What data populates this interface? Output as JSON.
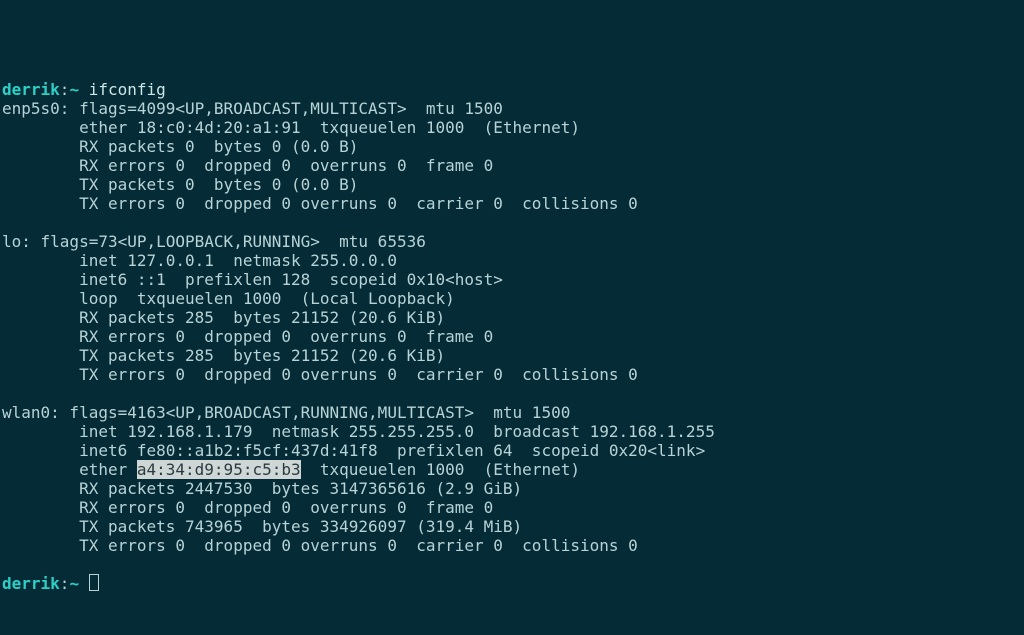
{
  "prompt1": {
    "user": "derrik",
    "sep": ":",
    "path": "~",
    "command": "ifconfig"
  },
  "prompt2": {
    "user": "derrik",
    "sep": ":",
    "path": "~",
    "command": ""
  },
  "iface1": {
    "header": "enp5s0: flags=4099<UP,BROADCAST,MULTICAST>  mtu 1500",
    "l2": "        ether 18:c0:4d:20:a1:91  txqueuelen 1000  (Ethernet)",
    "l3": "        RX packets 0  bytes 0 (0.0 B)",
    "l4": "        RX errors 0  dropped 0  overruns 0  frame 0",
    "l5": "        TX packets 0  bytes 0 (0.0 B)",
    "l6": "        TX errors 0  dropped 0 overruns 0  carrier 0  collisions 0"
  },
  "iface2": {
    "header": "lo: flags=73<UP,LOOPBACK,RUNNING>  mtu 65536",
    "l2": "        inet 127.0.0.1  netmask 255.0.0.0",
    "l3": "        inet6 ::1  prefixlen 128  scopeid 0x10<host>",
    "l4": "        loop  txqueuelen 1000  (Local Loopback)",
    "l5": "        RX packets 285  bytes 21152 (20.6 KiB)",
    "l6": "        RX errors 0  dropped 0  overruns 0  frame 0",
    "l7": "        TX packets 285  bytes 21152 (20.6 KiB)",
    "l8": "        TX errors 0  dropped 0 overruns 0  carrier 0  collisions 0"
  },
  "iface3": {
    "header": "wlan0: flags=4163<UP,BROADCAST,RUNNING,MULTICAST>  mtu 1500",
    "l2": "        inet 192.168.1.179  netmask 255.255.255.0  broadcast 192.168.1.255",
    "l3": "        inet6 fe80::a1b2:f5cf:437d:41f8  prefixlen 64  scopeid 0x20<link>",
    "l4a": "        ether ",
    "l4sel": "a4:34:d9:95:c5:b3",
    "l4b": "  txqueuelen 1000  (Ethernet)",
    "l5": "        RX packets 2447530  bytes 3147365616 (2.9 GiB)",
    "l6": "        RX errors 0  dropped 0  overruns 0  frame 0",
    "l7": "        TX packets 743965  bytes 334926097 (319.4 MiB)",
    "l8": "        TX errors 0  dropped 0 overruns 0  carrier 0  collisions 0"
  }
}
